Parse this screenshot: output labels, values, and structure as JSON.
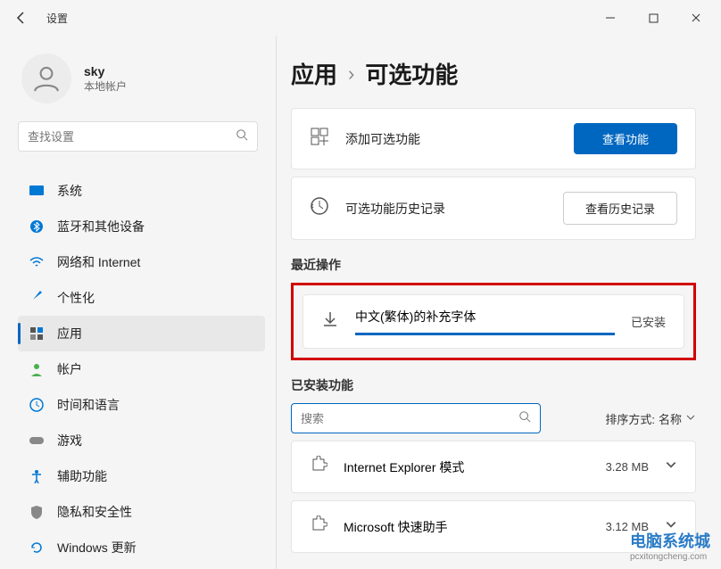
{
  "app_title": "设置",
  "user": {
    "name": "sky",
    "account_type": "本地帐户"
  },
  "sidebar": {
    "search_placeholder": "查找设置",
    "items": [
      {
        "label": "系统"
      },
      {
        "label": "蓝牙和其他设备"
      },
      {
        "label": "网络和 Internet"
      },
      {
        "label": "个性化"
      },
      {
        "label": "应用"
      },
      {
        "label": "帐户"
      },
      {
        "label": "时间和语言"
      },
      {
        "label": "游戏"
      },
      {
        "label": "辅助功能"
      },
      {
        "label": "隐私和安全性"
      },
      {
        "label": "Windows 更新"
      }
    ]
  },
  "breadcrumb": {
    "parent": "应用",
    "current": "可选功能"
  },
  "cards": {
    "add": {
      "label": "添加可选功能",
      "button": "查看功能"
    },
    "history": {
      "label": "可选功能历史记录",
      "button": "查看历史记录"
    }
  },
  "recent": {
    "heading": "最近操作",
    "item": {
      "name": "中文(繁体)的补充字体",
      "status": "已安装"
    }
  },
  "installed": {
    "heading": "已安装功能",
    "search_placeholder": "搜索",
    "sort_label": "排序方式:",
    "sort_value": "名称",
    "features": [
      {
        "name": "Internet Explorer 模式",
        "size": "3.28 MB"
      },
      {
        "name": "Microsoft 快速助手",
        "size": "3.12 MB"
      }
    ]
  },
  "watermark": {
    "main": "电脑系统城",
    "sub": "pcxitongcheng.com"
  }
}
